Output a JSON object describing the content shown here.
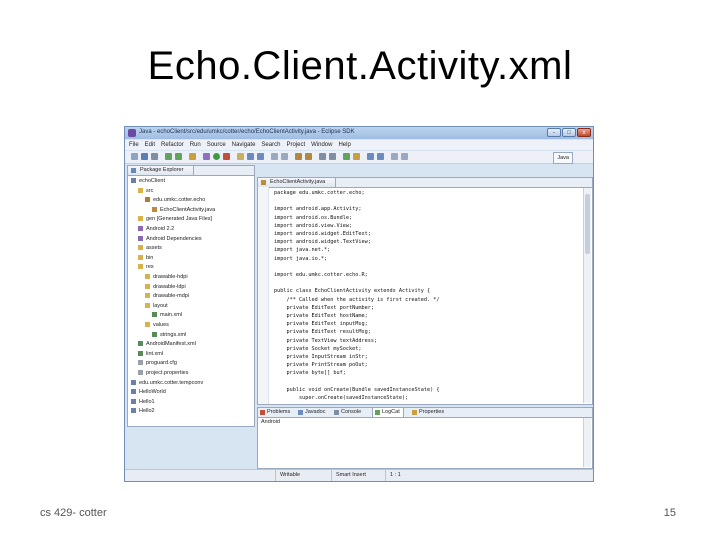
{
  "slide": {
    "title": "Echo.Client.Activity.xml",
    "footer_left": "cs 429- cotter",
    "page_number": "15"
  },
  "window": {
    "title": "Java - echoClient/src/edu/umkc/cotter/echo/EchoClientActivity.java - Eclipse SDK",
    "buttons": [
      "-",
      "□",
      "x"
    ]
  },
  "menubar": [
    "File",
    "Edit",
    "Refactor",
    "Run",
    "Source",
    "Navigate",
    "Search",
    "Project",
    "Window",
    "Help"
  ],
  "perspective": "Java",
  "package_explorer": {
    "tab_label": "Package Explorer",
    "items": [
      {
        "label": "echoClient",
        "indent": 1,
        "icon": "project"
      },
      {
        "label": "src",
        "indent": 2,
        "icon": "folder"
      },
      {
        "label": "edu.umkc.cotter.echo",
        "indent": 3,
        "icon": "package"
      },
      {
        "label": "EchoClientActivity.java",
        "indent": 4,
        "icon": "java"
      },
      {
        "label": "gen [Generated Java Files]",
        "indent": 2,
        "icon": "folder"
      },
      {
        "label": "Android 2.2",
        "indent": 2,
        "icon": "library"
      },
      {
        "label": "Android Dependencies",
        "indent": 2,
        "icon": "library"
      },
      {
        "label": "assets",
        "indent": 2,
        "icon": "folder"
      },
      {
        "label": "bin",
        "indent": 2,
        "icon": "folder"
      },
      {
        "label": "res",
        "indent": 2,
        "icon": "folder"
      },
      {
        "label": "drawable-hdpi",
        "indent": 3,
        "icon": "folder"
      },
      {
        "label": "drawable-ldpi",
        "indent": 3,
        "icon": "folder"
      },
      {
        "label": "drawable-mdpi",
        "indent": 3,
        "icon": "folder"
      },
      {
        "label": "layout",
        "indent": 3,
        "icon": "folder"
      },
      {
        "label": "main.xml",
        "indent": 4,
        "icon": "xml"
      },
      {
        "label": "values",
        "indent": 3,
        "icon": "folder"
      },
      {
        "label": "strings.xml",
        "indent": 4,
        "icon": "xml"
      },
      {
        "label": "AndroidManifest.xml",
        "indent": 2,
        "icon": "xml"
      },
      {
        "label": "lint.xml",
        "indent": 2,
        "icon": "xml"
      },
      {
        "label": "proguard.cfg",
        "indent": 2,
        "icon": "file"
      },
      {
        "label": "project.properties",
        "indent": 2,
        "icon": "file"
      },
      {
        "label": "edu.umkc.cotter.tempconv",
        "indent": 1,
        "icon": "project"
      },
      {
        "label": "HelloWorld",
        "indent": 1,
        "icon": "project"
      },
      {
        "label": "Hello1",
        "indent": 1,
        "icon": "project"
      },
      {
        "label": "Hello2",
        "indent": 1,
        "icon": "project"
      }
    ]
  },
  "editor": {
    "tab_label": "EchoClientActivity.java",
    "lines": [
      "package edu.umkc.cotter.echo;",
      "",
      "import android.app.Activity;",
      "import android.os.Bundle;",
      "import android.view.View;",
      "import android.widget.EditText;",
      "import android.widget.TextView;",
      "import java.net.*;",
      "import java.io.*;",
      "",
      "import edu.umkc.cotter.echo.R;",
      "",
      "public class EchoClientActivity extends Activity {",
      "    /** Called when the activity is first created. */",
      "    private EditText portNumber;",
      "    private EditText hostName;",
      "    private EditText inputMsg;",
      "    private EditText resultMsg;",
      "    private TextView textAddress;",
      "    private Socket mySocket;",
      "    private InputStream inStr;",
      "    private PrintStream poOut;",
      "    private byte[] buf;",
      "",
      "    public void onCreate(Bundle savedInstanceState) {",
      "        super.onCreate(savedInstanceState);"
    ]
  },
  "bottom_panel": {
    "tabs": [
      "Problems",
      "Javadoc",
      "Console",
      "LogCat",
      "Properties"
    ],
    "console_text": "Android"
  },
  "statusbar": {
    "mode": "Writable",
    "insert": "Smart Insert",
    "position": "1 : 1"
  }
}
